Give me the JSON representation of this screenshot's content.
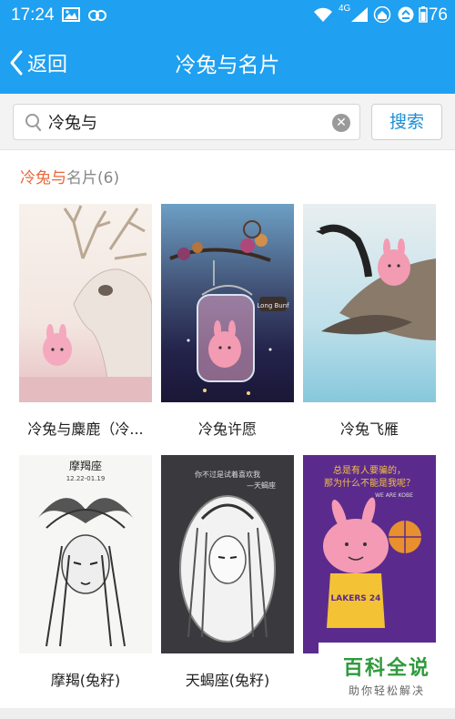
{
  "status_bar": {
    "time": "17:24",
    "network": "4G",
    "battery": "76"
  },
  "header": {
    "back_label": "返回",
    "title": "冷兔与名片"
  },
  "search": {
    "query": "冷兔与",
    "button_label": "搜索"
  },
  "results": {
    "highlight": "冷兔与",
    "rest": "名片",
    "count": "(6)"
  },
  "cards": [
    {
      "caption": "冷兔与麋鹿（冷..."
    },
    {
      "caption": "冷兔许愿",
      "sign_text": "Long Bunf"
    },
    {
      "caption": "冷兔飞雁"
    },
    {
      "caption": "摩羯(兔籽)",
      "header_text": "摩羯座",
      "date_text": "12.22-01.19"
    },
    {
      "caption": "天蝎座(兔籽)",
      "header_text": "你不过是试着喜欢我",
      "sub_text": "—天蝎座"
    },
    {
      "caption": "",
      "top_text_1": "总是有人要骗的，",
      "top_text_2": "那为什么不能是我呢？",
      "small_text": "WE ARE KOBE",
      "jersey_text": "LAKERS 24"
    }
  ],
  "watermark": {
    "title": "百科全说",
    "subtitle": "助你轻松解决"
  },
  "colors": {
    "brand_blue": "#1fa0f0",
    "highlight_orange": "#e9683a",
    "button_blue": "#1a8fd8",
    "watermark_green": "#2f9a3c"
  }
}
